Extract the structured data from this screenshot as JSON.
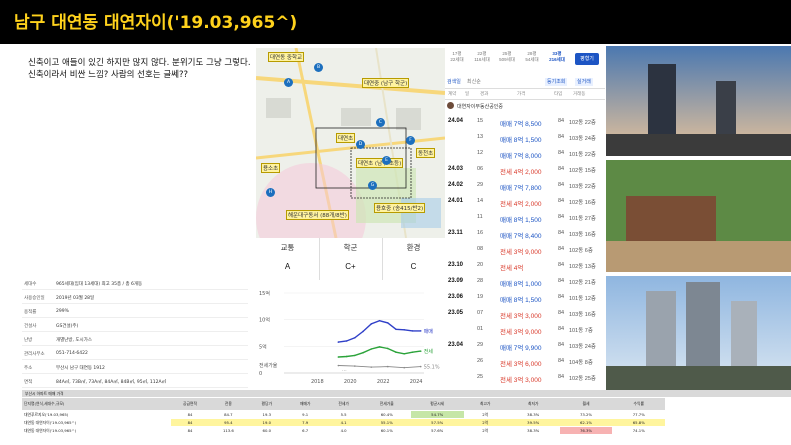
{
  "header": {
    "title": "남구 대연동 대연자이('19.03,965^)"
  },
  "notes": [
    "신축이고 애들이 있긴 하지만 많지 않다. 분위기도 그냥 그렇다.",
    "신축이라서 비싼 느낌? 사람의 선호는 글쎄??"
  ],
  "map": {
    "pois": [
      "대연동 중학교",
      "대연중 (남구 학군)",
      "대연초",
      "용소초",
      "동천초",
      "대연초 (남구 초등)",
      "용호중 (송415/반2)",
      "해운대구동서 (88개/8반)"
    ],
    "pins": [
      "A",
      "B",
      "C",
      "D",
      "E",
      "F",
      "G",
      "H"
    ],
    "colors": {
      "road": "#f7d77b",
      "park": "#cfe6b6",
      "water": "#a9cde8",
      "zone": "#f6c8d8",
      "block": "#d8dad3"
    }
  },
  "grades": [
    {
      "label": "교통",
      "value": "A"
    },
    {
      "label": "학군",
      "value": "C+"
    },
    {
      "label": "환경",
      "value": "C"
    }
  ],
  "info": {
    "rows": [
      {
        "k": "세대수",
        "v": "965세대(임대 13세대) 최고 35층 / 총 6개동"
      },
      {
        "k": "사용승인일",
        "v": "2019년 03월 28일"
      },
      {
        "k": "용적률",
        "v": "299%"
      },
      {
        "k": "건설사",
        "v": "GS건설(주)"
      },
      {
        "k": "난방",
        "v": "개별난방, 도시가스"
      },
      {
        "k": "관리사무소",
        "v": "051-714-6422"
      },
      {
        "k": "주소",
        "v": "부산시 남구 대연동 1912"
      },
      {
        "k": "면적",
        "v": "84A㎡, 73B㎡, 73A㎡, 84A㎡, 84B㎡, 95㎡, 112A㎡"
      }
    ]
  },
  "price_panel": {
    "tabs": [
      {
        "area": "17평",
        "count": "22세대"
      },
      {
        "area": "22평",
        "count": "116세대"
      },
      {
        "area": "25평",
        "count": "509세대"
      },
      {
        "area": "28평",
        "count": "54세대"
      },
      {
        "area": "33평",
        "count": "216세대"
      }
    ],
    "button": "평형기",
    "filter": "검색일",
    "sort": "최신순",
    "tools": [
      "등기조회",
      "실거래"
    ],
    "header_cols": [
      "계약",
      "일",
      "경과",
      "가격",
      "타입",
      "거래동"
    ],
    "agent": "대연자이부동산공인중",
    "rows": [
      {
        "ym": "24.04",
        "day": "15",
        "type": "매매",
        "price": "7억 8,500",
        "area": "84",
        "floor": "102동 22층"
      },
      {
        "ym": "",
        "day": "13",
        "type": "매매",
        "price": "8억 1,500",
        "area": "84",
        "floor": "103동 24층"
      },
      {
        "ym": "",
        "day": "12",
        "type": "매매",
        "price": "7억 8,000",
        "area": "84",
        "floor": "101동 22층"
      },
      {
        "ym": "24.03",
        "day": "06",
        "type": "전세",
        "price": "4억 2,000",
        "area": "84",
        "floor": "102동 15층"
      },
      {
        "ym": "24.02",
        "day": "29",
        "type": "매매",
        "price": "7억 7,800",
        "area": "84",
        "floor": "103동 22층"
      },
      {
        "ym": "24.01",
        "day": "14",
        "type": "전세",
        "price": "4억 2,000",
        "area": "84",
        "floor": "102동 16층"
      },
      {
        "ym": "",
        "day": "11",
        "type": "매매",
        "price": "8억 1,500",
        "area": "84",
        "floor": "101동 27층"
      },
      {
        "ym": "23.11",
        "day": "16",
        "type": "매매",
        "price": "7억 8,400",
        "area": "84",
        "floor": "103동 16층"
      },
      {
        "ym": "",
        "day": "08",
        "type": "전세",
        "price": "3억 9,000",
        "area": "84",
        "floor": "102동 6층"
      },
      {
        "ym": "23.10",
        "day": "20",
        "type": "전세",
        "price": "4억",
        "area": "84",
        "floor": "102동 13층"
      },
      {
        "ym": "23.09",
        "day": "28",
        "type": "매매",
        "price": "8억 1,000",
        "area": "84",
        "floor": "102동 21층"
      },
      {
        "ym": "23.06",
        "day": "19",
        "type": "매매",
        "price": "8억 1,500",
        "area": "84",
        "floor": "101동 12층"
      },
      {
        "ym": "23.05",
        "day": "07",
        "type": "전세",
        "price": "3억 3,000",
        "area": "84",
        "floor": "103동 16층"
      },
      {
        "ym": "",
        "day": "01",
        "type": "전세",
        "price": "3억 9,000",
        "area": "84",
        "floor": "101동 7층"
      },
      {
        "ym": "23.04",
        "day": "29",
        "type": "매매",
        "price": "7억 9,900",
        "area": "84",
        "floor": "103동 24층"
      },
      {
        "ym": "",
        "day": "26",
        "type": "전세",
        "price": "3억 6,000",
        "area": "84",
        "floor": "104동 8층"
      },
      {
        "ym": "",
        "day": "25",
        "type": "전세",
        "price": "3억 3,000",
        "area": "84",
        "floor": "102동 25층"
      }
    ],
    "colors": {
      "sale": "#1d55c4",
      "lease": "#d93a2b"
    }
  },
  "chart_data": {
    "type": "line",
    "title": "",
    "ylabel": "",
    "xlabel": "",
    "yticks": [
      "15억",
      "10억",
      "5억",
      "0"
    ],
    "xticks": [
      "2018",
      "2020",
      "2022",
      "2024"
    ],
    "ylim": [
      0,
      15
    ],
    "xlim": [
      2016,
      2024.5
    ],
    "legend_bottom": "전세가율",
    "legend_extra": "...",
    "series": [
      {
        "name": "매매",
        "color": "#3040c8",
        "x": [
          2019.3,
          2019.8,
          2020.3,
          2020.8,
          2021.3,
          2021.8,
          2022.3,
          2022.8,
          2023.3,
          2023.8,
          2024.3
        ],
        "values": [
          5.8,
          6.0,
          6.6,
          7.8,
          9.2,
          9.8,
          9.4,
          8.2,
          8.1,
          7.9,
          7.9
        ]
      },
      {
        "name": "전세",
        "color": "#2ba33a",
        "x": [
          2019.3,
          2019.8,
          2020.3,
          2020.8,
          2021.3,
          2021.8,
          2022.3,
          2022.8,
          2023.3,
          2023.8,
          2024.3
        ],
        "values": [
          3.0,
          3.1,
          3.3,
          3.8,
          4.5,
          4.9,
          4.6,
          3.9,
          3.6,
          3.9,
          4.1
        ]
      },
      {
        "name": "전세가율",
        "color": "#888888",
        "x": [
          2019.3,
          2020.3,
          2021.3,
          2022.3,
          2023.3,
          2024.3
        ],
        "values": [
          1.4,
          1.3,
          1.1,
          1.2,
          1.0,
          1.2
        ]
      }
    ],
    "rate_label": "55.1%"
  },
  "bottom_table": {
    "title": "부산시 아파트 매매 가격",
    "headers": [
      "단지명(연식,세대수,규모)",
      "공급면적",
      "전용",
      "평당가",
      "매매가",
      "전세가",
      "전세가율",
      "평균시세",
      "최고가",
      "최저가",
      "월세",
      "수익률"
    ],
    "rows": [
      [
        "대연푸르지오('19.03,965)",
        "84",
        "84.7",
        "19.3",
        "9.1",
        "5.5",
        "60.4%",
        "54.7%",
        "2억",
        "38.3%",
        "73.2%",
        "77.7%"
      ],
      [
        "대연동 대연자이('19.03,965^)",
        "84",
        "95.4",
        "19.0",
        "7.9",
        "4.1",
        "55.1%",
        "57.5%",
        "2억",
        "39.5%",
        "62.1%",
        "65.8%"
      ],
      [
        "대연동 대연자이('19.03,965^)",
        "84",
        "113.6",
        "60.0",
        "6.7",
        "4.0",
        "60.1%",
        "57.6%",
        "2억",
        "38.3%",
        "76.3%",
        "74.1%"
      ]
    ],
    "colors": {
      "head": "#d9d9d9",
      "highlight": "#fff59e",
      "green": "#c6e6a7",
      "red": "#f7b2b2"
    }
  }
}
